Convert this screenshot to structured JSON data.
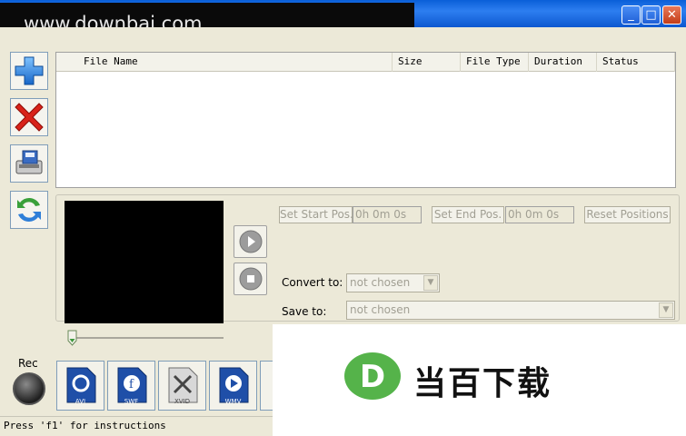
{
  "watermark_text": "www.downbai.com",
  "window_controls": {
    "minimize": "_",
    "maximize": "□",
    "close": "✕"
  },
  "toolbar": [
    {
      "icon": "add-icon"
    },
    {
      "icon": "delete-icon"
    },
    {
      "icon": "save-icon"
    },
    {
      "icon": "refresh-icon"
    }
  ],
  "file_list": {
    "columns": [
      "File Name",
      "Size",
      "File Type",
      "Duration",
      "Status"
    ]
  },
  "position": {
    "set_start_label": "Set Start Pos.",
    "start_value": "0h 0m 0s",
    "set_end_label": "Set End Pos.",
    "end_value": "0h 0m 0s",
    "reset_label": "Reset Positions"
  },
  "convert": {
    "convert_to_label": "Convert to:",
    "convert_to_value": "not chosen",
    "save_to_label": "Save to:",
    "save_to_value": "not chosen"
  },
  "rec_label": "Rec",
  "formats": [
    {
      "label": "AVI",
      "color": "#1f4fa8"
    },
    {
      "label": "SWF",
      "color": "#1f4fa8"
    },
    {
      "label": "XVID",
      "color": "#6e6e6e"
    },
    {
      "label": "WMV",
      "color": "#1f4fa8"
    }
  ],
  "status_text": "Press 'f1' for instructions",
  "logo": {
    "letter": "D",
    "text": "当百下载",
    "color": "#55b34a"
  }
}
